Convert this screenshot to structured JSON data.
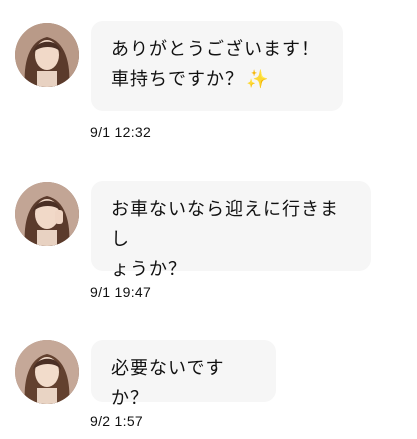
{
  "messages": [
    {
      "text": "ありがとうございます！\n車持ちですか？",
      "emoji": "✨",
      "time": "9/1 12:32",
      "avatar_icon": "user-avatar-icon"
    },
    {
      "text": "お車ないなら迎えに行きまし\nょうか？",
      "time": "9/1 19:47",
      "avatar_icon": "user-avatar-icon"
    },
    {
      "text": "必要ないですか？",
      "time": "9/2 1:57",
      "avatar_icon": "user-avatar-icon"
    }
  ],
  "colors": {
    "bubble_bg": "#f6f6f6",
    "text": "#111111",
    "sparkle": "#f3c623"
  }
}
